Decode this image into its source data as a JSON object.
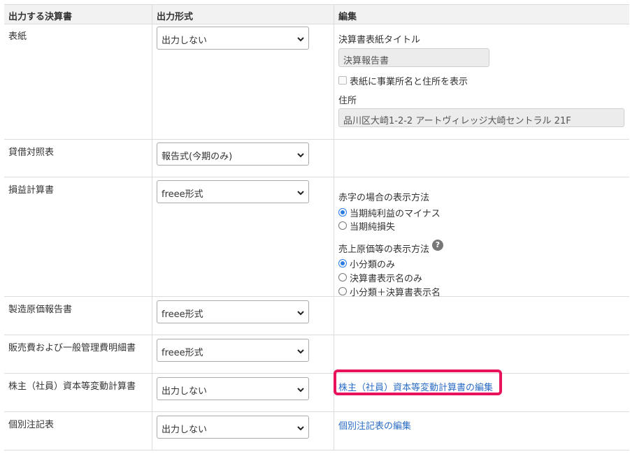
{
  "header": {
    "col1": "出力する決算書",
    "col2": "出力形式",
    "col3": "編集"
  },
  "rows": [
    {
      "label": "表紙",
      "select": "出力しない",
      "edit": {
        "title_label": "決算書表紙タイトル",
        "title_value": "決算報告書",
        "checkbox_label": "表紙に事業所名と住所を表示",
        "address_label": "住所",
        "address_value": "品川区大崎1-2-2 アートヴィレッジ大崎セントラル 21F"
      }
    },
    {
      "label": "貸借対照表",
      "select": "報告式(今期のみ)"
    },
    {
      "label": "損益計算書",
      "select": "freee形式",
      "edit": {
        "deficit_label": "赤字の場合の表示方法",
        "deficit_options": [
          "当期純利益のマイナス",
          "当期純損失"
        ],
        "cogs_label": "売上原価等の表示方法",
        "help_glyph": "?",
        "cogs_options": [
          "小分類のみ",
          "決算書表示名のみ",
          "小分類＋決算書表示名"
        ]
      }
    },
    {
      "label": "製造原価報告書",
      "select": "freee形式"
    },
    {
      "label": "販売費および一般管理費明細書",
      "select": "freee形式"
    },
    {
      "label": "株主（社員）資本等変動計算書",
      "select": "出力しない",
      "link": "株主（社員）資本等変動計算書の編集"
    },
    {
      "label": "個別注記表",
      "select": "出力しない",
      "link": "個別注記表の編集"
    }
  ],
  "colors": {
    "link": "#2b6cc4",
    "highlight": "#e8135c",
    "radio_selected": "#2a7ae2"
  }
}
